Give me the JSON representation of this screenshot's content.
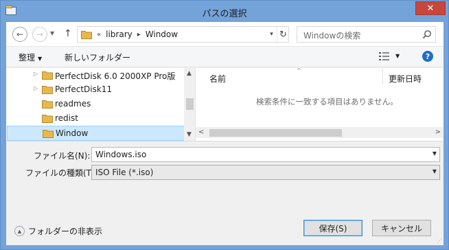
{
  "window": {
    "title": "パスの選択",
    "close_label": "✕"
  },
  "nav": {
    "path": [
      "library",
      "Window"
    ],
    "overflow_marker": "«",
    "search_placeholder": "Windowの検索"
  },
  "command_bar": {
    "organize_label": "整理",
    "new_folder_label": "新しいフォルダー"
  },
  "tree": {
    "items": [
      {
        "label": "PerfectDisk 6.0 2000XP Pro版",
        "expandable": true,
        "selected": false
      },
      {
        "label": "PerfectDisk11",
        "expandable": true,
        "selected": false
      },
      {
        "label": "readmes",
        "expandable": false,
        "selected": false
      },
      {
        "label": "redist",
        "expandable": false,
        "selected": false
      },
      {
        "label": "Window",
        "expandable": false,
        "selected": true
      }
    ]
  },
  "file_list": {
    "columns": [
      "名前",
      "更新日時"
    ],
    "empty_message": "検索条件に一致する項目はありません。"
  },
  "form": {
    "filename_label": "ファイル名(N):",
    "filename_value": "Windows.iso",
    "filetype_label": "ファイルの種類(T):",
    "filetype_value": "ISO File (*.iso)"
  },
  "footer": {
    "hide_folders_label": "フォルダーの非表示",
    "save_label": "保存(S)",
    "cancel_label": "キャンセル"
  },
  "colors": {
    "folder": "#e8b84a",
    "selection": "#cce8ff",
    "close": "#c7463d",
    "accent": "#1f6fc8"
  }
}
